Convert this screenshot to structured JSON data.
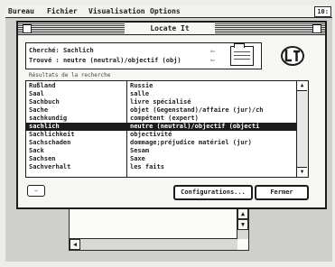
{
  "menubar": {
    "items": [
      "Bureau",
      "Fichier",
      "Visualisation",
      "Options"
    ],
    "clock": "10:"
  },
  "dialog": {
    "title": "Locate It",
    "search_label": "Cherché:",
    "search_value": "Sachlich",
    "found_label": "Trouvé :",
    "found_value": "neutre (neutral)/objectif (obj)",
    "nav_arrows": "⇦\n⇦",
    "list_heading": "Résultats de la recherche",
    "rows": [
      {
        "term": "Rußland",
        "translation": "Russie"
      },
      {
        "term": "Saal",
        "translation": "salle"
      },
      {
        "term": "Sachbuch",
        "translation": "livre spécialisé"
      },
      {
        "term": "Sache",
        "translation": "objet (Gegenstand)/affaire (jur)/ch"
      },
      {
        "term": "sachkundig",
        "translation": "compétent (expert)"
      },
      {
        "term": "sachlich",
        "translation": "neutre (neutral)/objectif (objecti"
      },
      {
        "term": "Sachlichkeit",
        "translation": "objectivité"
      },
      {
        "term": "Sachschaden",
        "translation": "dommage;préjudice matériel (jur)"
      },
      {
        "term": "Sack",
        "translation": "Sesam"
      },
      {
        "term": "Sachsen",
        "translation": "Saxe"
      },
      {
        "term": "Sachverhalt",
        "translation": "les faits"
      }
    ],
    "selected_index": 5,
    "small_button": "—",
    "config_button": "Configurations...",
    "close_button": "Fermer"
  }
}
